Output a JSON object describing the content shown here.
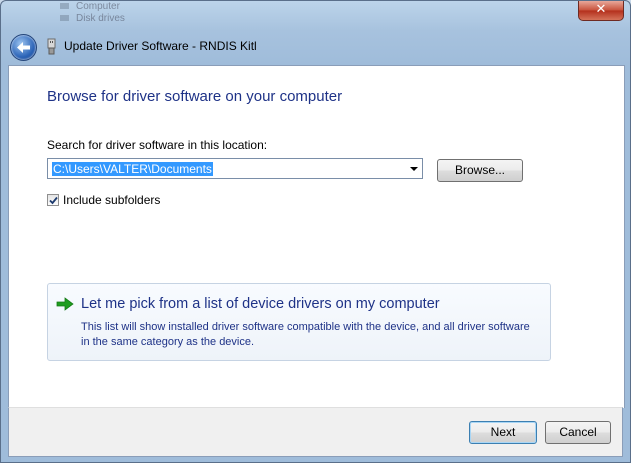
{
  "window": {
    "title": "Update Driver Software - RNDIS Kitl",
    "close_label": "✕",
    "background_items": [
      "Computer",
      "Disk drives"
    ]
  },
  "main": {
    "heading": "Browse for driver software on your computer",
    "search_label": "Search for driver software in this location:",
    "path_value": "C:\\Users\\VALTER\\Documents",
    "browse_label": "Browse...",
    "include_subfolders": {
      "label": "Include subfolders",
      "checked": true
    },
    "pick_option": {
      "title": "Let me pick from a list of device drivers on my computer",
      "description": "This list will show installed driver software compatible with the device, and all driver software in the same category as the device."
    }
  },
  "footer": {
    "next_label": "Next",
    "cancel_label": "Cancel"
  },
  "colors": {
    "heading": "#1e3287",
    "selection": "#3399ff",
    "green_arrow": "#1f9d1f"
  },
  "icons": [
    "back-arrow-icon",
    "device-icon",
    "check-icon",
    "green-arrow-icon",
    "dropdown-arrow-icon",
    "close-icon"
  ]
}
